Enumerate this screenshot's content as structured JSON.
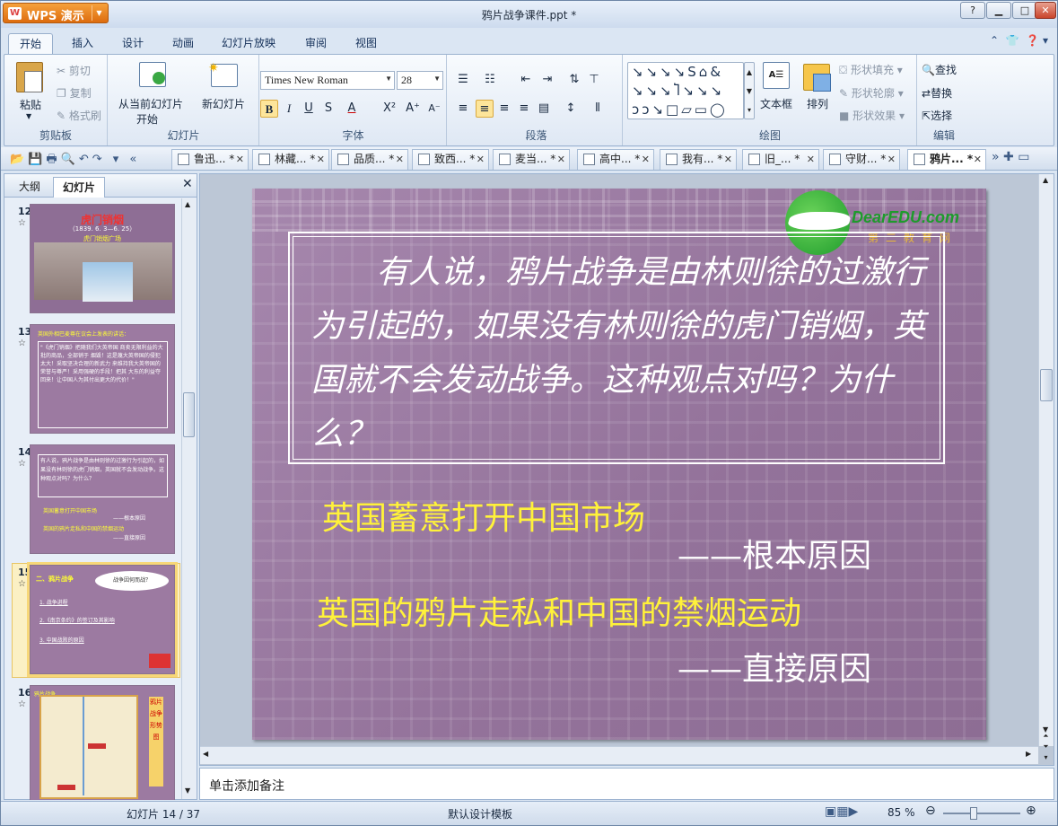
{
  "app": {
    "name": "WPS 演示",
    "file_title": "鸦片战争课件.ppt *"
  },
  "ribbon_tabs": [
    "开始",
    "插入",
    "设计",
    "动画",
    "幻灯片放映",
    "审阅",
    "视图"
  ],
  "clipboard": {
    "paste": "粘贴",
    "cut": "剪切",
    "copy": "复制",
    "format_painter": "格式刷",
    "label": "剪贴板"
  },
  "slides_group": {
    "from_current": "从当前幻灯片",
    "start": "开始",
    "new_slide": "新幻灯片",
    "label": "幻灯片"
  },
  "font": {
    "name": "Times New Roman",
    "size": "28",
    "label": "字体",
    "bold": "B",
    "italic": "I",
    "underline": "U",
    "strike": "S"
  },
  "paragraph": {
    "label": "段落"
  },
  "drawing": {
    "text_box": "文本框",
    "arrange": "排列",
    "shape_fill": "形状填充",
    "shape_outline": "形状轮廓",
    "shape_effect": "形状效果",
    "label": "绘图"
  },
  "editing": {
    "find": "查找",
    "replace": "替换",
    "select": "选择",
    "label": "编辑"
  },
  "doc_tabs": [
    "鲁迅... *",
    "林藏... *",
    "品质... *",
    "致西... *",
    "麦当... *",
    "高中... *",
    "我有... *",
    "旧_... *",
    "守财... *",
    "鸦片... *"
  ],
  "pane_tabs": {
    "outline": "大纲",
    "slides": "幻灯片"
  },
  "thumbs": [
    {
      "num": "12",
      "title": "虎门销烟",
      "sub": "（1839. 6. 3—6. 25）",
      "cap": "虎门销烟广场"
    },
    {
      "num": "13",
      "head": "英国外相巴麦尊在议会上发表的讲话：",
      "body": "\"《虎门销烟》把随我们大英帝国 商卖无限利益的大批的商品，全部销于 烟毁！这是蔑大英帝国的侵犯太大！采取坚决合理的新武力 来维持我大英帝国的荣誉与尊严！采用强硬的手段！把其 大东的利益夺回来！让中国人为其付出更大的代价！\""
    },
    {
      "num": "14",
      "para": "有人说，鸦片战争是由林则徐的过激行为引起的，如果没有林则徐的虎门销烟，英国就不会发动战争。这种观点对吗？为什么？",
      "l1": "英国蓄意打开中国市场",
      "l2": "——根本原因",
      "l3": "英国的鸦片走私和中国的禁烟运动",
      "l4": "——直接原因"
    },
    {
      "num": "15",
      "h": "二、鸦片战争",
      "bubble": "战争因何而战？",
      "i1": "1. 战争进程",
      "i2": "2.《南京条约》的签订及其影响",
      "i3": "3. 中国战败的原因"
    },
    {
      "num": "16",
      "title": "鸦片战争",
      "v": "鸦片战争形势图"
    }
  ],
  "slide": {
    "paragraph": "有人说，鸦片战争是由林则徐的过激行为引起的，如果没有林则徐的虎门销烟，英国就不会发动战争。这种观点对吗？为什么？",
    "line1": "英国蓄意打开中国市场",
    "line2": "——根本原因",
    "line3": "英国的鸦片走私和中国的禁烟运动",
    "line4": "——直接原因",
    "logo_text": "DearEDU.com",
    "logo_cn": "第二教育网"
  },
  "notes_placeholder": "单击添加备注",
  "status": {
    "slide_count": "幻灯片 14 / 37",
    "template": "默认设计模板",
    "zoom": "85 %"
  }
}
